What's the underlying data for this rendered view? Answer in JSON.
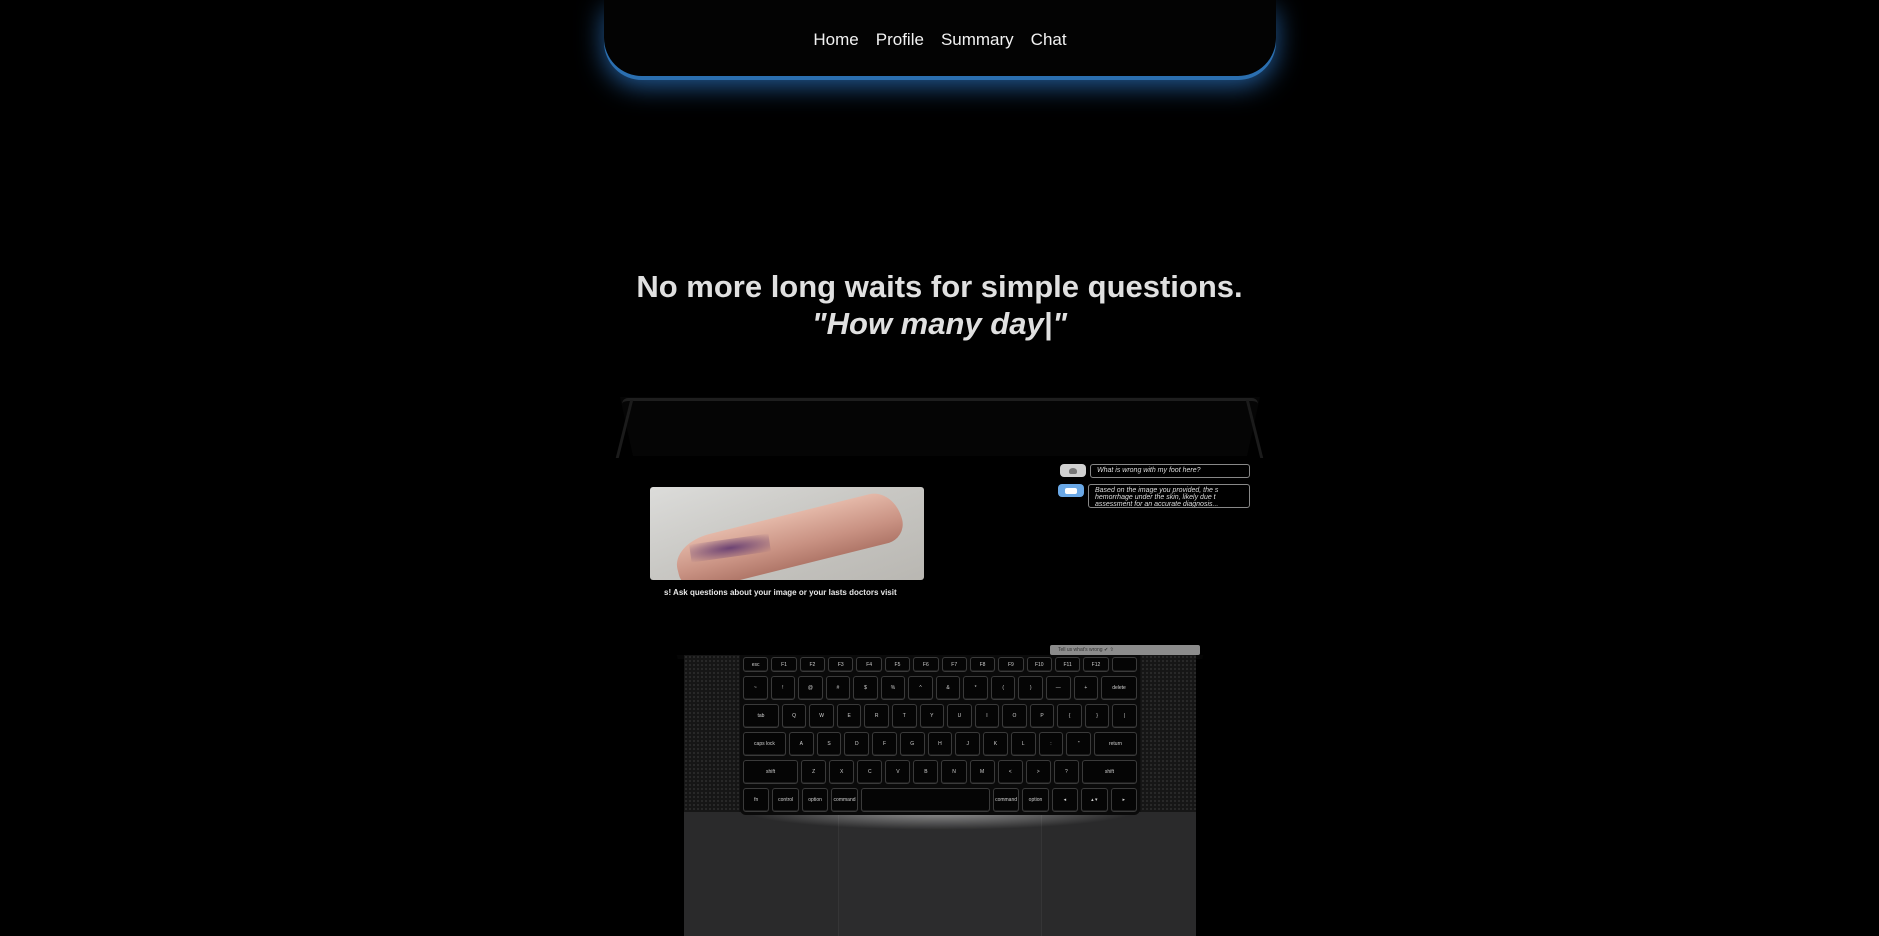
{
  "nav": {
    "items": [
      {
        "label": "Home"
      },
      {
        "label": "Profile"
      },
      {
        "label": "Summary"
      },
      {
        "label": "Chat"
      }
    ],
    "glow_color": "#2b6fb0"
  },
  "hero": {
    "headline": "No more long waits for simple questions.",
    "typing_quote": "\"How many day|\""
  },
  "laptop_screen": {
    "prompt": "s! Ask questions about your image or your lasts doctors visit",
    "chat": {
      "user_message": "What is wrong with my foot here?",
      "bot_message": "Based on the image you provided, the s hemorrhage under the skin, likely due t assessment for an accurate diagnosis..."
    },
    "input_placeholder": "Tell us what's wrong ✔ ⇧"
  },
  "keyboard": {
    "rows": [
      [
        "esc",
        "F1",
        "F2",
        "F3",
        "F4",
        "F5",
        "F6",
        "F7",
        "F8",
        "F9",
        "F10",
        "F11",
        "F12",
        ""
      ],
      [
        "~",
        "!",
        "@",
        "#",
        "$",
        "%",
        "^",
        "&",
        "*",
        "(",
        ")",
        "—",
        "+",
        "delete"
      ],
      [
        "tab",
        "Q",
        "W",
        "E",
        "R",
        "T",
        "Y",
        "U",
        "I",
        "O",
        "P",
        "{",
        "}",
        "|"
      ],
      [
        "caps lock",
        "A",
        "S",
        "D",
        "F",
        "G",
        "H",
        "J",
        "K",
        "L",
        ":",
        "\"",
        "return"
      ],
      [
        "shift",
        "Z",
        "X",
        "C",
        "V",
        "B",
        "N",
        "M",
        "<",
        ">",
        "?",
        "shift"
      ],
      [
        "fn",
        "control",
        "option",
        "command",
        "",
        "command",
        "option",
        "◂",
        "▴ ▾",
        "▸"
      ]
    ]
  }
}
